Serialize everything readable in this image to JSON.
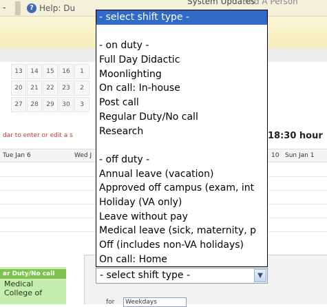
{
  "topbar": {
    "dash": "-",
    "help_icon": "?",
    "help_text": "Help: Du",
    "system_updates": "System Updates",
    "find_person": "Find A Person"
  },
  "mini_calendar": [
    [
      "13",
      "14",
      "15",
      "16",
      "1"
    ],
    [
      "20",
      "21",
      "22",
      "23",
      "2"
    ],
    [
      "27",
      "28",
      "29",
      "30",
      "3"
    ]
  ],
  "hint_text": "dar to enter or edit a s",
  "hours_text": "18:30 hour",
  "week_header": {
    "tue": "Tue Jan 6",
    "wed": "Wed J",
    "ten": "10",
    "sun": "Sun Jan 1"
  },
  "duty_block": {
    "title": "ar Duty/No call",
    "line1": "Medical",
    "line2": "College of"
  },
  "select_value": "- select shift type -",
  "dropdown_options": [
    {
      "label": "- select shift type -",
      "selected": true
    },
    {
      "label": "",
      "selected": false
    },
    {
      "label": "- on duty -",
      "selected": false
    },
    {
      "label": "Full Day Didactic",
      "selected": false
    },
    {
      "label": "Moonlighting",
      "selected": false
    },
    {
      "label": "On call: In-house",
      "selected": false
    },
    {
      "label": "Post call",
      "selected": false
    },
    {
      "label": "Regular Duty/No call",
      "selected": false
    },
    {
      "label": "Research",
      "selected": false
    },
    {
      "label": "",
      "selected": false
    },
    {
      "label": "- off duty -",
      "selected": false
    },
    {
      "label": "Annual leave (vacation)",
      "selected": false
    },
    {
      "label": "Approved off campus (exam, int",
      "selected": false
    },
    {
      "label": "Holiday (VA only)",
      "selected": false
    },
    {
      "label": "Leave without pay",
      "selected": false
    },
    {
      "label": "Medical leave (sick, maternity, p",
      "selected": false
    },
    {
      "label": "Off (includes non-VA holidays)",
      "selected": false
    },
    {
      "label": "On call: Home",
      "selected": false
    }
  ],
  "for_label": "for",
  "mini_select_value": "Weekdays",
  "colors": {
    "selected_highlight": "#3169c6",
    "duty_green": "#7fc24f",
    "hint_red": "#c0392b"
  },
  "icons": {
    "help": "help-icon",
    "dropdown_arrow": "chevron-down-icon"
  }
}
